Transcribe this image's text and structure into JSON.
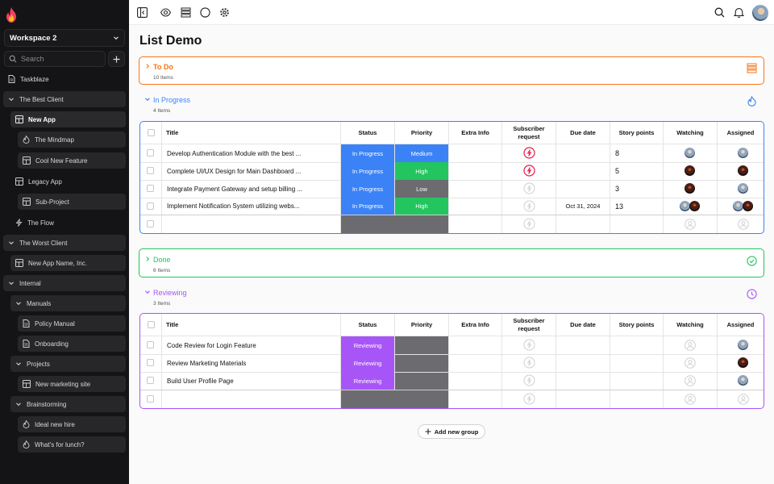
{
  "sidebar": {
    "workspace": "Workspace 2",
    "search_placeholder": "Search",
    "items": [
      {
        "label": "Taskblaze",
        "icon": "document-icon"
      },
      {
        "label": "The Best Client",
        "icon": "chevron-down-icon"
      },
      {
        "label": "New App",
        "icon": "board-icon"
      },
      {
        "label": "The Mindmap",
        "icon": "flame-icon"
      },
      {
        "label": "Cool New Feature",
        "icon": "board-icon"
      },
      {
        "label": "Legacy App",
        "icon": "board-icon"
      },
      {
        "label": "Sub-Project",
        "icon": "board-icon"
      },
      {
        "label": "The Flow",
        "icon": "bolt-icon"
      },
      {
        "label": "The Worst Client",
        "icon": "chevron-down-icon"
      },
      {
        "label": "New App Name, Inc.",
        "icon": "board-icon"
      },
      {
        "label": "Internal",
        "icon": "chevron-down-icon"
      },
      {
        "label": "Manuals",
        "icon": "chevron-down-icon"
      },
      {
        "label": "Policy Manual",
        "icon": "document-icon"
      },
      {
        "label": "Onboarding",
        "icon": "document-icon"
      },
      {
        "label": "Projects",
        "icon": "chevron-down-icon"
      },
      {
        "label": "New marketing site",
        "icon": "board-icon"
      },
      {
        "label": "Brainstorming",
        "icon": "chevron-down-icon"
      },
      {
        "label": "Ideal new hire",
        "icon": "flame-icon"
      },
      {
        "label": "What's for lunch?",
        "icon": "flame-icon"
      }
    ]
  },
  "page": {
    "title": "List Demo"
  },
  "columns": [
    "Title",
    "Status",
    "Priority",
    "Extra Info",
    "Subscriber request",
    "Due date",
    "Story points",
    "Watching",
    "Assigned"
  ],
  "groups": {
    "todo": {
      "name": "To Do",
      "count": "10 Items",
      "color": "#f97316"
    },
    "inprogress": {
      "name": "In Progress",
      "count": "4 Items",
      "color": "#3b82f6"
    },
    "done": {
      "name": "Done",
      "count": "6 Items",
      "color": "#22c55e"
    },
    "reviewing": {
      "name": "Reviewing",
      "count": "3 Items",
      "color": "#a855f7"
    }
  },
  "inprogress_rows": [
    {
      "title": "Develop Authentication Module with the best ...",
      "status": "In Progress",
      "priority": "Medium",
      "priority_color": "#3b82f6",
      "due": "",
      "points": "8"
    },
    {
      "title": "Complete UI/UX Design for Main Dashboard ...",
      "status": "In Progress",
      "priority": "High",
      "priority_color": "#22c55e",
      "due": "",
      "points": "5"
    },
    {
      "title": "Integrate Payment Gateway and setup billing ...",
      "status": "In Progress",
      "priority": "Low",
      "priority_color": "#6b6b70",
      "due": "",
      "points": "3"
    },
    {
      "title": "Implement Notification System utilizing webs...",
      "status": "In Progress",
      "priority": "High",
      "priority_color": "#22c55e",
      "due": "Oct 31, 2024",
      "points": "13"
    }
  ],
  "reviewing_rows": [
    {
      "title": "Code Review for Login Feature",
      "status": "Reviewing"
    },
    {
      "title": "Review Marketing Materials",
      "status": "Reviewing"
    },
    {
      "title": "Build User Profile Page",
      "status": "Reviewing"
    }
  ],
  "add_group_label": "Add new group",
  "colors": {
    "in_progress": "#3b82f6",
    "reviewing": "#a855f7",
    "empty_cell": "#6b6b70",
    "subscriber": "#e11d48"
  }
}
